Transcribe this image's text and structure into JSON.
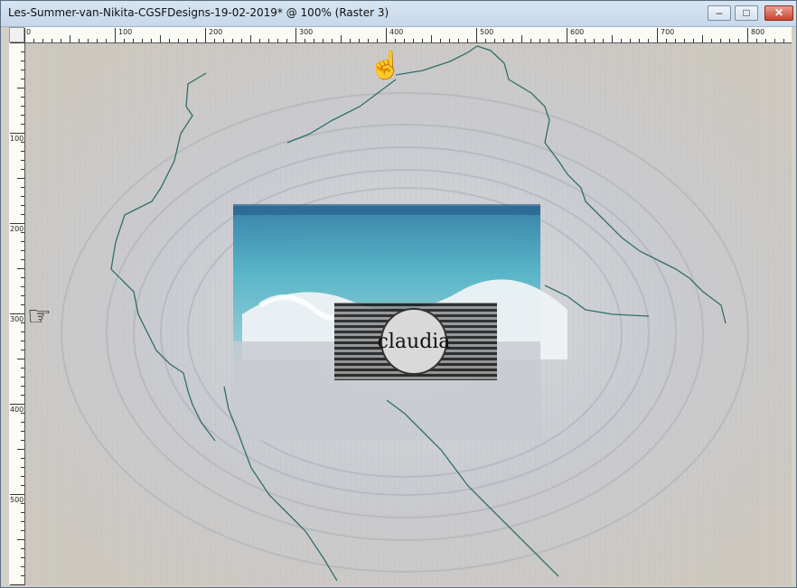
{
  "window": {
    "title": "Les-Summer-van-Nikita-CGSFDesigns-19-02-2019* @ 100% (Raster 3)",
    "minimize_glyph": "–",
    "maximize_glyph": "□",
    "close_glyph": "✕"
  },
  "rulers": {
    "horizontal_labels": [
      "0",
      "100",
      "200",
      "300",
      "400",
      "500",
      "600",
      "700",
      "800"
    ],
    "vertical_labels": [
      "100",
      "200",
      "300",
      "400",
      "500"
    ]
  },
  "canvas": {
    "zoom": "100%",
    "layer": "Raster 3",
    "colors": {
      "sand": "#cfcbc4",
      "sea": "#4fb4c8",
      "selection_line": "#2f6f6a",
      "pointer": "#f5c400"
    }
  },
  "watermark": {
    "text": "claudia"
  },
  "pointers": [
    {
      "name": "pointer-up-icon",
      "glyph": "☝"
    },
    {
      "name": "pointer-right-icon",
      "glyph": "☞"
    }
  ]
}
